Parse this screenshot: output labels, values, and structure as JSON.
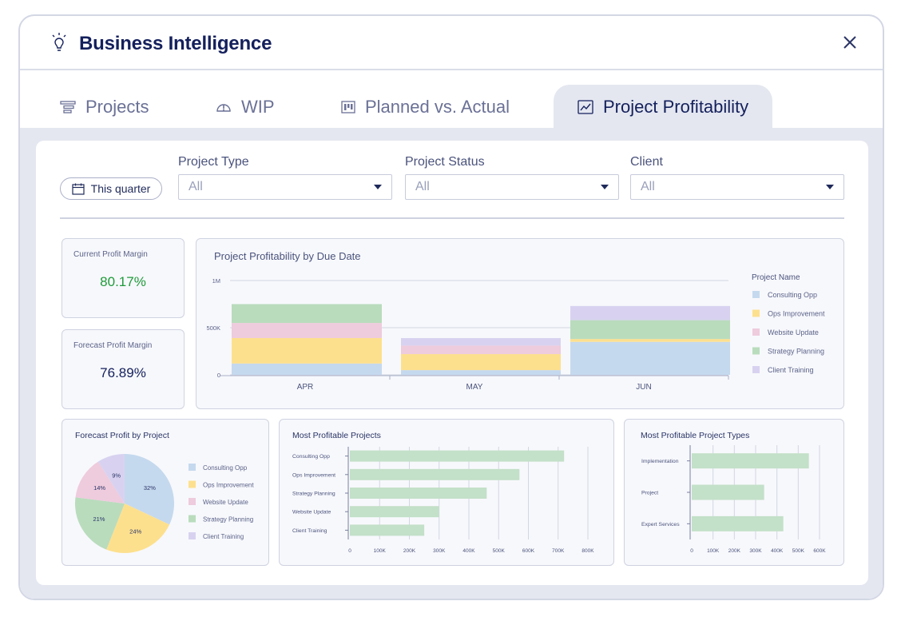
{
  "window": {
    "title": "Business Intelligence"
  },
  "tabs": [
    {
      "label": "Projects",
      "icon": "list-icon",
      "active": false
    },
    {
      "label": "WIP",
      "icon": "gauge-icon",
      "active": false
    },
    {
      "label": "Planned vs. Actual",
      "icon": "kanban-icon",
      "active": false
    },
    {
      "label": "Project Profitability",
      "icon": "line-chart-icon",
      "active": true
    }
  ],
  "filters": {
    "date_button": "This quarter",
    "project_type": {
      "label": "Project Type",
      "value": "All"
    },
    "project_status": {
      "label": "Project Status",
      "value": "All"
    },
    "client": {
      "label": "Client",
      "value": "All"
    }
  },
  "kpis": {
    "current": {
      "label": "Current Profit Margin",
      "value": "80.17%",
      "color": "#1f9a3a"
    },
    "forecast": {
      "label": "Forecast Profit Margin",
      "value": "76.89%",
      "color": "#14205c"
    }
  },
  "colors": {
    "Consulting Opp": "#c5d9ee",
    "Ops Improvement": "#fde08e",
    "Website Update": "#eecbdd",
    "Strategy Planning": "#b9dcbd",
    "Client Training": "#d8d2f0",
    "bar": "#c3e0c8"
  },
  "chart_data": [
    {
      "type": "bar",
      "stacked": true,
      "title": "Project Profitability by Due Date",
      "categories": [
        "APR",
        "MAY",
        "JUN"
      ],
      "yticks": [
        "0",
        "500K",
        "1M"
      ],
      "ylim": [
        0,
        1000000
      ],
      "legend_title": "Project Name",
      "legend_position": "right",
      "series": [
        {
          "name": "Consulting Opp",
          "values": [
            120000,
            50000,
            350000
          ]
        },
        {
          "name": "Ops Improvement",
          "values": [
            270000,
            170000,
            30000
          ]
        },
        {
          "name": "Website Update",
          "values": [
            160000,
            90000,
            0
          ]
        },
        {
          "name": "Strategy Planning",
          "values": [
            200000,
            0,
            200000
          ]
        },
        {
          "name": "Client Training",
          "values": [
            0,
            80000,
            150000
          ]
        }
      ]
    },
    {
      "type": "pie",
      "title": "Forecast Profit by Project",
      "legend_position": "right",
      "slices": [
        {
          "name": "Consulting Opp",
          "value": 32,
          "label": "32%"
        },
        {
          "name": "Ops Improvement",
          "value": 24,
          "label": "24%"
        },
        {
          "name": "Strategy Planning",
          "value": 21,
          "label": "21%"
        },
        {
          "name": "Website Update",
          "value": 14,
          "label": "14%"
        },
        {
          "name": "Client Training",
          "value": 9,
          "label": "9%"
        }
      ]
    },
    {
      "type": "bar",
      "orientation": "horizontal",
      "title": "Most Profitable Projects",
      "categories": [
        "Consulting Opp",
        "Ops Improvement",
        "Strategy Planning",
        "Website Update",
        "Client Training"
      ],
      "values": [
        720000,
        570000,
        460000,
        300000,
        250000
      ],
      "xticks": [
        "0",
        "100K",
        "200K",
        "300K",
        "400K",
        "500K",
        "600K",
        "700K",
        "800K"
      ],
      "xlim": [
        0,
        800000
      ]
    },
    {
      "type": "bar",
      "orientation": "horizontal",
      "title": "Most Profitable Project Types",
      "categories": [
        "Implementation",
        "Project",
        "Expert Services"
      ],
      "values": [
        550000,
        340000,
        430000
      ],
      "xticks": [
        "0",
        "100K",
        "200K",
        "300K",
        "400K",
        "500K",
        "600K"
      ],
      "xlim": [
        0,
        600000
      ]
    }
  ]
}
